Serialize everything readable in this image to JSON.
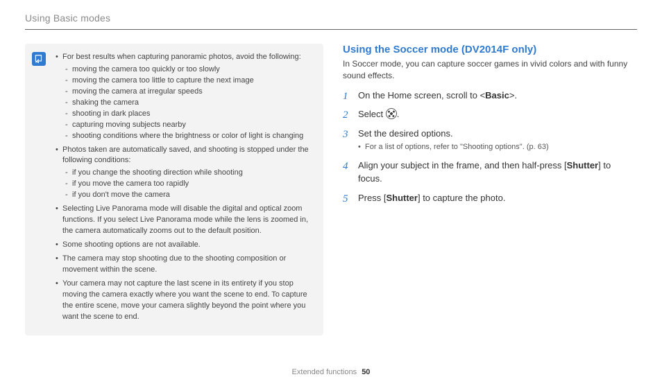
{
  "section_title": "Using Basic modes",
  "tips": {
    "bullets": [
      {
        "text": "For best results when capturing panoramic photos, avoid the following:",
        "sub": [
          "moving the camera too quickly or too slowly",
          "moving the camera too little to capture the next image",
          "moving the camera at irregular speeds",
          "shaking the camera",
          "shooting in dark places",
          "capturing moving subjects nearby",
          "shooting conditions where the brightness or color of light is changing"
        ]
      },
      {
        "text": "Photos taken are automatically saved, and shooting is stopped under the following conditions:",
        "sub": [
          "if you change the shooting direction while shooting",
          "if you move the camera too rapidly",
          "if you don't move the camera"
        ]
      },
      {
        "text": "Selecting Live Panorama mode will disable the digital and optical zoom functions. If you select Live Panorama mode while the lens is zoomed in, the camera automatically zooms out to the default position."
      },
      {
        "text": "Some shooting options are not available."
      },
      {
        "text": "The camera may stop shooting due to the shooting composition or movement within the scene."
      },
      {
        "text": "Your camera may not capture the last scene in its entirety if you stop moving the camera exactly where you want the scene to end. To capture the entire scene, move your camera slightly beyond the point where you want the scene to end."
      }
    ]
  },
  "right": {
    "heading": "Using the Soccer mode (DV2014F only)",
    "intro": "In Soccer mode, you can capture soccer games in vivid colors and with funny sound effects.",
    "step1_pre": "On the Home screen, scroll to <",
    "step1_bold": "Basic",
    "step1_post": ">.",
    "step2": "Select ",
    "step2_post": ".",
    "step3": "Set the desired options.",
    "step3_sub": "For a list of options, refer to \"Shooting options\". (p. 63)",
    "step4_pre": "Align your subject in the frame, and then half-press [",
    "step4_bold": "Shutter",
    "step4_post": "] to focus.",
    "step5_pre": "Press [",
    "step5_bold": "Shutter",
    "step5_post": "] to capture the photo."
  },
  "footer": {
    "label": "Extended functions",
    "page": "50"
  }
}
